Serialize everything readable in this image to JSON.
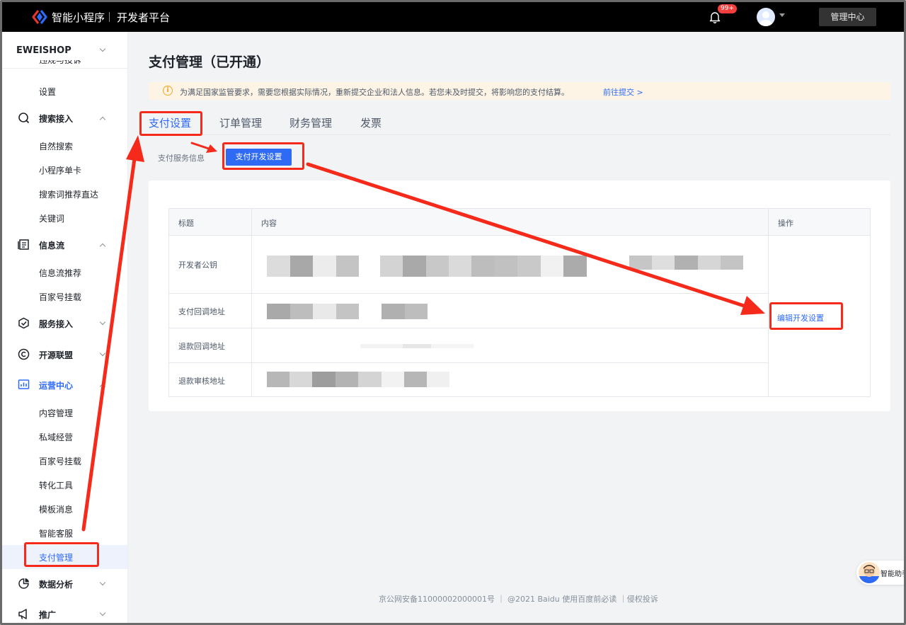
{
  "topbar": {
    "brand": "智能小程序",
    "platform": "开发者平台",
    "notification_count": "99+",
    "admin_center": "管理中心"
  },
  "sidebar": {
    "shop": "EWEISHOP",
    "cut_item": "违规与投诉",
    "items": [
      {
        "label": "设置"
      },
      {
        "label": "搜索接入"
      },
      {
        "label": "自然搜索"
      },
      {
        "label": "小程序单卡"
      },
      {
        "label": "搜索词推荐直达"
      },
      {
        "label": "关键词"
      },
      {
        "label": "信息流"
      },
      {
        "label": "信息流推荐"
      },
      {
        "label": "百家号挂载"
      },
      {
        "label": "服务接入"
      },
      {
        "label": "开源联盟"
      },
      {
        "label": "运营中心"
      },
      {
        "label": "内容管理"
      },
      {
        "label": "私域经营"
      },
      {
        "label": "百家号挂载"
      },
      {
        "label": "转化工具"
      },
      {
        "label": "模板消息"
      },
      {
        "label": "智能客服"
      },
      {
        "label": "支付管理"
      },
      {
        "label": "数据分析"
      },
      {
        "label": "推广"
      }
    ]
  },
  "main": {
    "title": "支付管理（已开通）",
    "notice": "为满足国家监管要求，需要您根据实际情况，重新提交企业和法人信息。若您未及时提交，将影响您的支付结算。",
    "notice_link": "前往提交 >",
    "tabs": [
      "支付设置",
      "订单管理",
      "财务管理",
      "发票"
    ],
    "subtab_info": "支付服务信息",
    "subtab_dev": "支付开发设置",
    "table": {
      "headers": [
        "标题",
        "内容",
        "操作"
      ],
      "rows": [
        "开发者公钥",
        "支付回调地址",
        "退款回调地址",
        "退款审核地址"
      ],
      "action": "编辑开发设置"
    }
  },
  "footer": "京公网安备11000002000001号 ｜ @2021 Baidu 使用百度前必读 ｜侵权投诉",
  "helper": "智能助手",
  "colors": {
    "accent": "#2f6af5",
    "annotation_red": "#f52a1a",
    "topbar": "#000000",
    "notice_bg": "#fdf4e5"
  }
}
